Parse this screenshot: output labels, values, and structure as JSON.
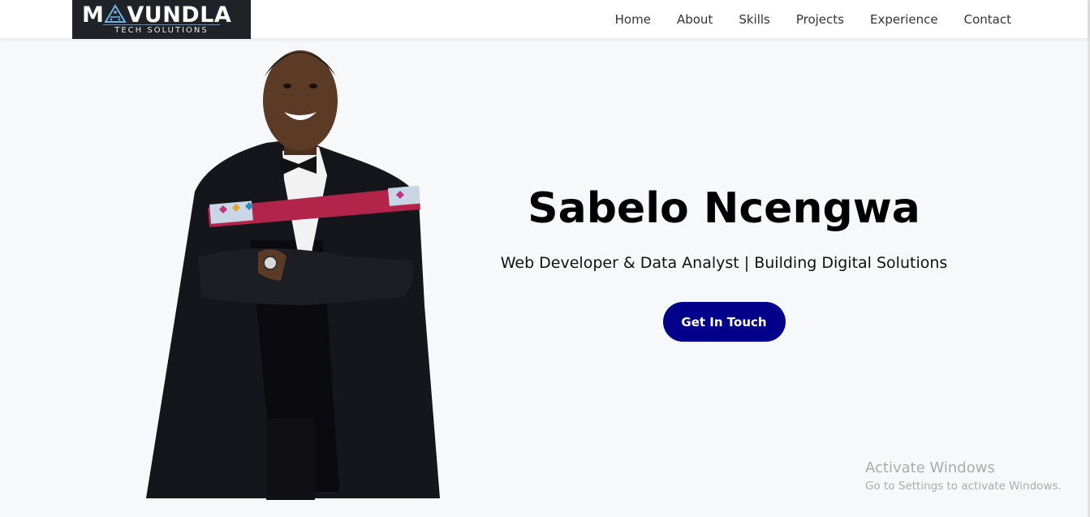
{
  "logo": {
    "main_text": "M VUNDLA",
    "sub_text": "TECH SOLUTIONS",
    "icon": "circuit-logo-mark"
  },
  "nav": {
    "items": [
      {
        "label": "Home"
      },
      {
        "label": "About"
      },
      {
        "label": "Skills"
      },
      {
        "label": "Projects"
      },
      {
        "label": "Experience"
      },
      {
        "label": "Contact"
      }
    ]
  },
  "hero": {
    "name": "Sabelo Ncengwa",
    "tagline": "Web Developer & Data Analyst | Building Digital Solutions",
    "cta_label": "Get In Touch",
    "photo": "profile-photo-graduation-gown"
  },
  "watermark": {
    "title": "Activate Windows",
    "subtitle": "Go to Settings to activate Windows."
  },
  "colors": {
    "accent": "#00008b",
    "navbar_bg": "#ffffff",
    "page_bg": "#f7f8fa",
    "logo_bg": "#1f2327"
  }
}
